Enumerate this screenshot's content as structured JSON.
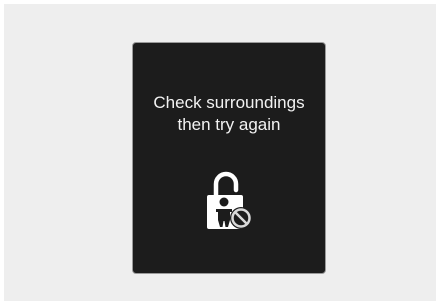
{
  "dialog": {
    "message_line1": "Check surroundings",
    "message_line2": "then try again",
    "icon": "child-lock-unavailable-icon"
  },
  "colors": {
    "background": "#eeeeee",
    "screen": "#1c1c1c",
    "text": "#f2f2f2",
    "icon": "#ffffff",
    "prohibited": "#d9d9d9"
  }
}
